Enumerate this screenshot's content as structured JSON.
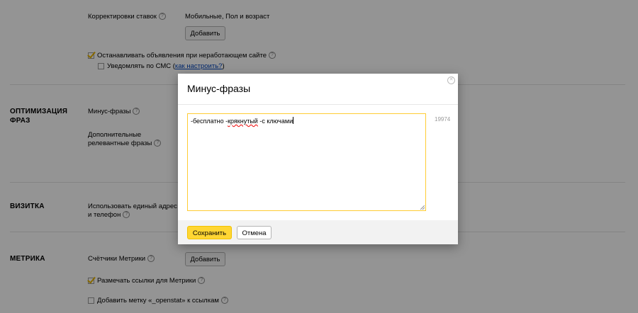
{
  "background": {
    "bid_adjustments": {
      "label": "Корректировки ставок",
      "value": "Мобильные, Пол и возраст",
      "add_button": "Добавить"
    },
    "stop_ads": {
      "label": "Останавливать объявления при неработающем сайте",
      "checked": true
    },
    "sms_notify": {
      "label": "Уведомлять по СМС (",
      "link": "как настроить?",
      "suffix": ")",
      "checked": false
    },
    "optimization": {
      "title_line1": "ОПТИМИЗАЦИЯ",
      "title_line2": "ФРАЗ",
      "minus_phrases_label": "Минус-фразы",
      "extra_phrases_line1": "Дополнительные",
      "extra_phrases_line2": "релевантные фразы"
    },
    "vcard": {
      "title": "ВИЗИТКА",
      "line1": "Использовать единый адрес",
      "line2": "и телефон"
    },
    "metrika": {
      "title": "МЕТРИКА",
      "counters_label": "Счётчики Метрики",
      "add_button": "Добавить",
      "mark_links_label": "Размечать ссылки для Метрики",
      "mark_links_checked": true,
      "openstat_label": "Добавить метку «_openstat» к ссылкам",
      "openstat_checked": false
    }
  },
  "modal": {
    "title": "Минус-фразы",
    "text_before": "-бесплатно -",
    "text_misspelled": "крякнутый",
    "text_after": " -с ключами",
    "char_counter": "19974",
    "save_label": "Сохранить",
    "cancel_label": "Отмена"
  },
  "colors": {
    "accent": "#ffd633",
    "focus_border": "#ffcc33",
    "link": "#0044bb",
    "overlay": "rgba(0,0,0,0.42)"
  }
}
